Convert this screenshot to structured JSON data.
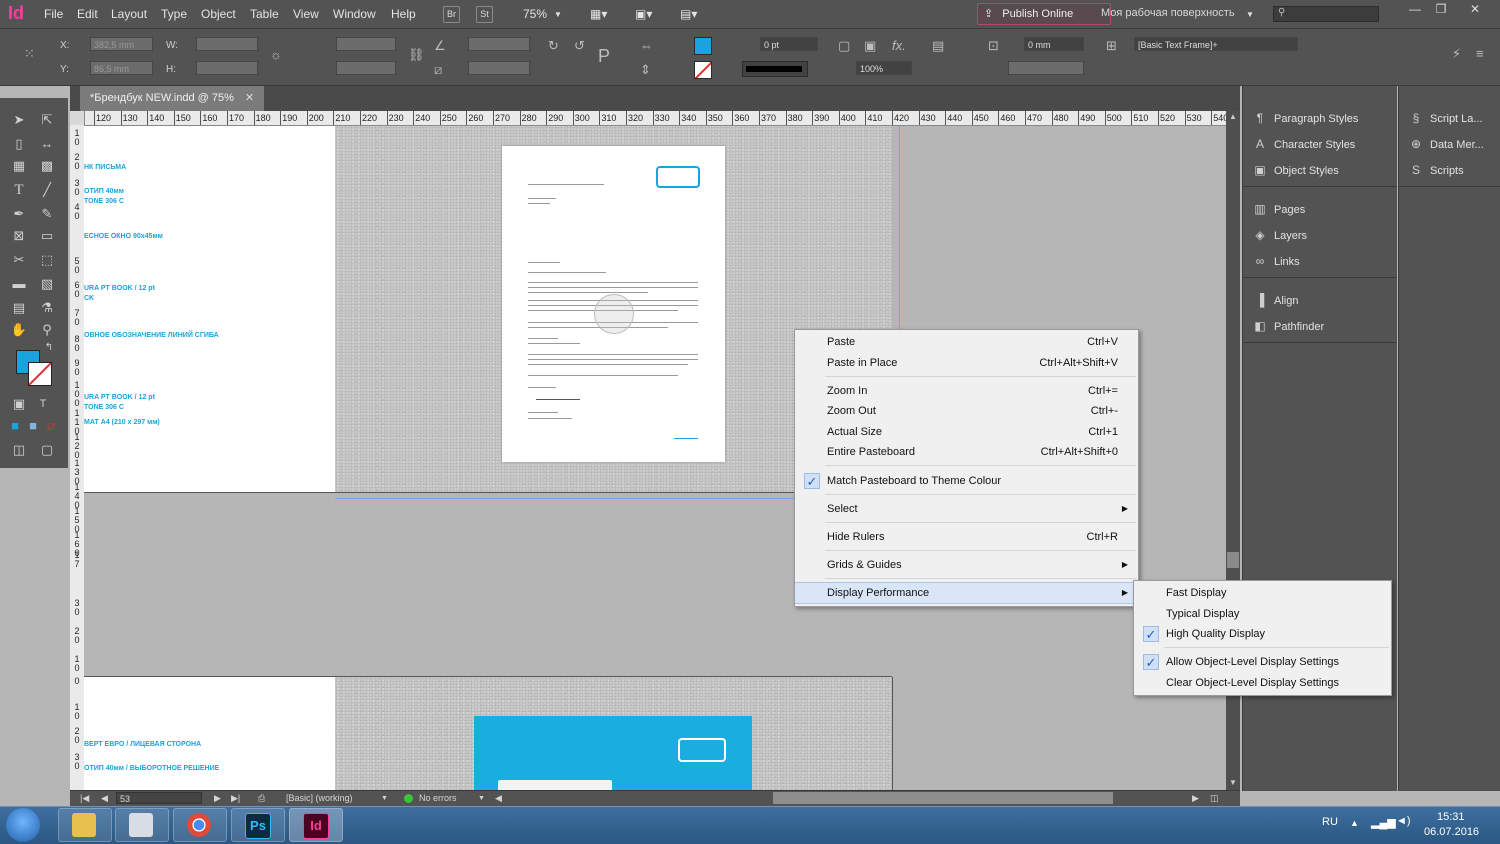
{
  "app": {
    "logo": "Id",
    "menu": [
      "File",
      "Edit",
      "Layout",
      "Type",
      "Object",
      "Table",
      "View",
      "Window",
      "Help"
    ],
    "bridge_label": "Br",
    "stock_label": "St",
    "zoom": "75%",
    "publish_label": "Publish Online",
    "workspace": "Моя рабочая поверхность"
  },
  "control": {
    "x_label": "X:",
    "y_label": "Y:",
    "w_label": "W:",
    "h_label": "H:",
    "x_value": "382,5 mm",
    "y_value": "86,5 mm",
    "stroke_weight": "0 pt",
    "opacity": "100%",
    "inset": "0 mm",
    "object_style": "[Basic Text Frame]+"
  },
  "document": {
    "tab_title": "*Брендбук NEW.indd @ 75%"
  },
  "ruler": {
    "h_ticks": [
      "120",
      "130",
      "140",
      "150",
      "160",
      "170",
      "180",
      "190",
      "200",
      "210",
      "220",
      "230",
      "240",
      "250",
      "260",
      "270",
      "280",
      "290",
      "300",
      "310",
      "320",
      "330",
      "340",
      "350",
      "360",
      "370",
      "380",
      "390",
      "400",
      "410",
      "420",
      "430",
      "440",
      "450",
      "460",
      "470",
      "480",
      "490",
      "500",
      "510",
      "520",
      "530",
      "540"
    ],
    "v_ticks": [
      "1 0",
      "2 0",
      "3 0",
      "4 0",
      "5 0",
      "6 0",
      "7 0",
      "8 0",
      "9 0",
      "1 0 0",
      "1 1 0",
      "1 2 0",
      "1 3 0",
      "1 4 0",
      "1 5 0",
      "1 6 0",
      "1 7",
      "3 0",
      "2 0",
      "1 0",
      "0",
      "1 0",
      "2 0",
      "3 0"
    ]
  },
  "specs_page1": [
    "НК ПИСЬМА",
    "ОТИП 40мм",
    "TONE 306 C",
    "ЕСНОЕ ОКНО 90х45мм",
    "URA PT BOOK / 12 pt",
    "CK",
    "ОВНОЕ ОБОЗНАЧЕНИЕ ЛИНИЙ СГИБА",
    "URA PT BOOK / 12 pt",
    "TONE 306 C",
    "МАТ A4 (210 x 297 мм)"
  ],
  "specs_page2": [
    "ВЕРТ ЕВРО / ЛИЦЕВАЯ СТОРОНА",
    "ОТИП 40мм / ВЫБОРОТНОЕ РЕШЕНИЕ"
  ],
  "context_menu": {
    "items": [
      {
        "label": "Paste",
        "shortcut": "Ctrl+V"
      },
      {
        "label": "Paste in Place",
        "shortcut": "Ctrl+Alt+Shift+V"
      },
      {
        "label": "Zoom In",
        "shortcut": "Ctrl+="
      },
      {
        "label": "Zoom Out",
        "shortcut": "Ctrl+-"
      },
      {
        "label": "Actual Size",
        "shortcut": "Ctrl+1"
      },
      {
        "label": "Entire Pasteboard",
        "shortcut": "Ctrl+Alt+Shift+0"
      },
      {
        "label": "Match Pasteboard to Theme Colour",
        "shortcut": ""
      },
      {
        "label": "Select",
        "shortcut": ""
      },
      {
        "label": "Hide Rulers",
        "shortcut": "Ctrl+R"
      },
      {
        "label": "Grids & Guides",
        "shortcut": ""
      },
      {
        "label": "Display Performance",
        "shortcut": ""
      }
    ]
  },
  "submenu": {
    "items": [
      {
        "label": "Fast Display"
      },
      {
        "label": "Typical Display"
      },
      {
        "label": "High Quality Display"
      },
      {
        "label": "Allow Object-Level Display Settings"
      },
      {
        "label": "Clear Object-Level Display Settings"
      }
    ]
  },
  "panels": {
    "col1": [
      "Paragraph Styles",
      "Character Styles",
      "Object Styles",
      "Pages",
      "Layers",
      "Links",
      "Align",
      "Pathfinder"
    ],
    "col2": [
      "Script La...",
      "Data Mer...",
      "Scripts"
    ]
  },
  "status": {
    "page": "53",
    "master": "[Basic] (working)",
    "preflight": "No errors"
  },
  "taskbar": {
    "ps_label": "Ps",
    "id_label": "Id",
    "lang": "RU",
    "time": "15:31",
    "date": "06.07.2016"
  },
  "colors": {
    "accent": "#1aa3dc",
    "indesign": "#ff3c9d",
    "ok": "#3ac43a"
  }
}
